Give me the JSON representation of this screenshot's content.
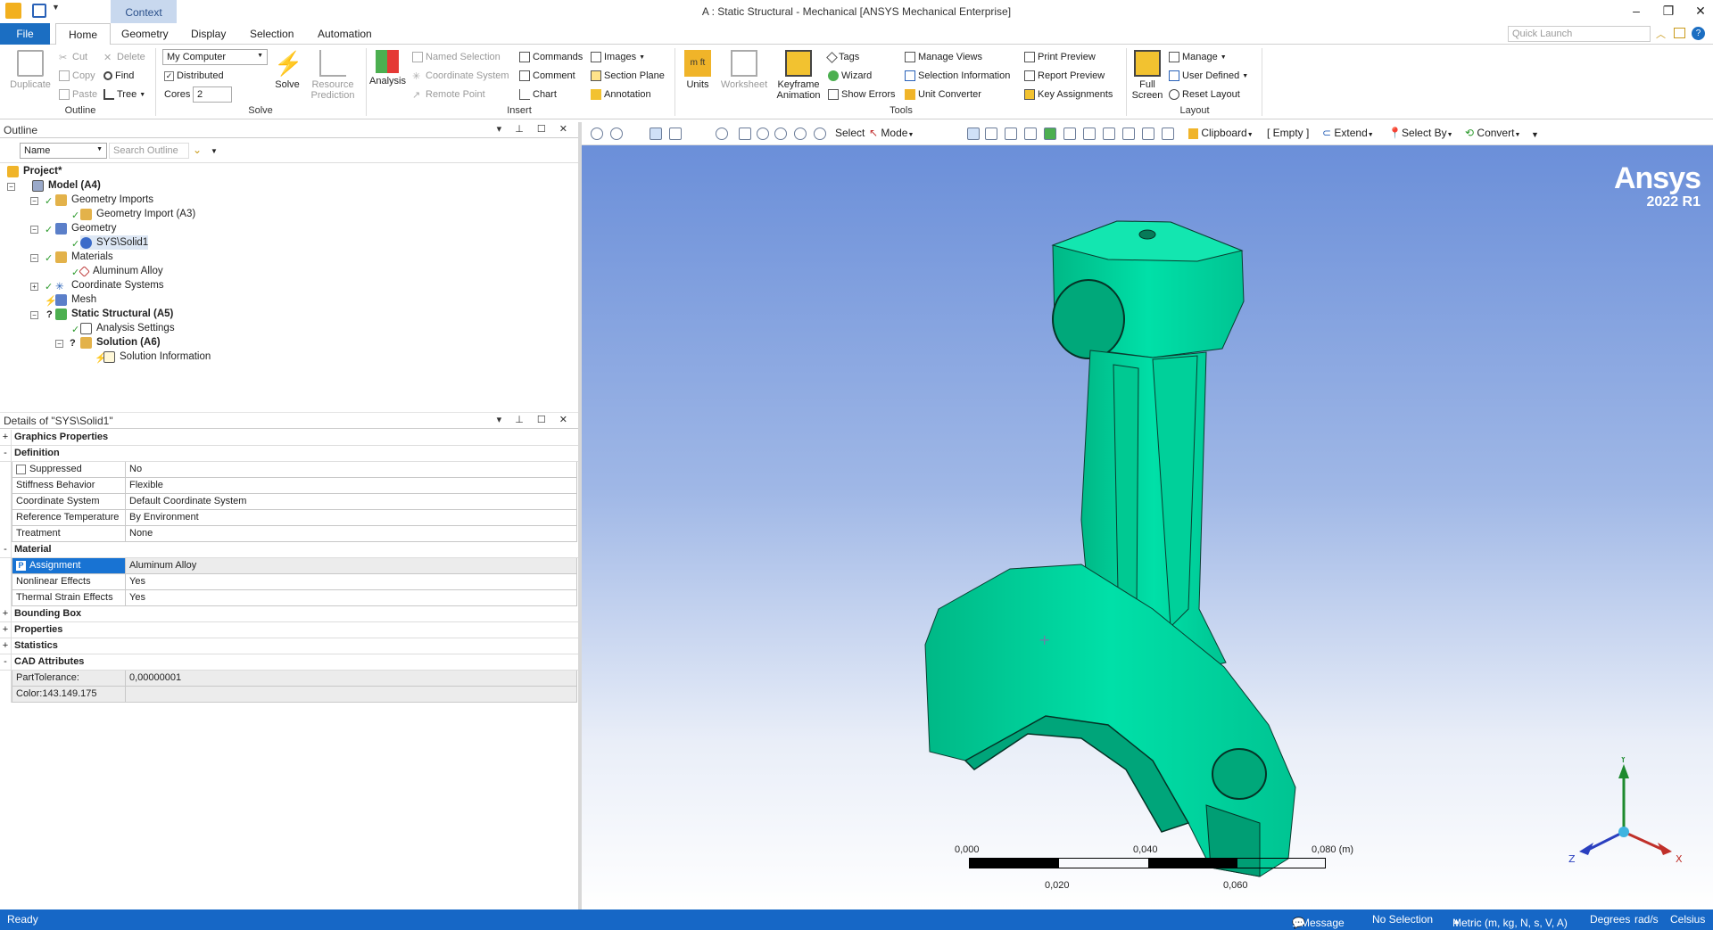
{
  "window": {
    "title": "A : Static Structural - Mechanical [ANSYS Mechanical Enterprise]",
    "context_tab": "Context"
  },
  "ribbon_tabs": [
    "File",
    "Home",
    "Geometry",
    "Display",
    "Selection",
    "Automation"
  ],
  "quick_launch_placeholder": "Quick Launch",
  "ribbon": {
    "outline": {
      "group_label": "Outline",
      "duplicate": "Duplicate",
      "cut": "Cut",
      "copy": "Copy",
      "paste": "Paste",
      "delete": "Delete",
      "find": "Find",
      "tree": "Tree"
    },
    "solve": {
      "group_label": "Solve",
      "computer": "My Computer",
      "distributed": "Distributed",
      "cores_label": "Cores",
      "cores_value": "2",
      "solve": "Solve",
      "resource_prediction_1": "Resource",
      "resource_prediction_2": "Prediction"
    },
    "insert": {
      "group_label": "Insert",
      "analysis": "Analysis",
      "named_selection": "Named Selection",
      "coordinate_system": "Coordinate System",
      "remote_point": "Remote Point",
      "commands": "Commands",
      "comment": "Comment",
      "chart": "Chart",
      "images": "Images",
      "section_plane": "Section Plane",
      "annotation": "Annotation"
    },
    "tools": {
      "group_label": "Tools",
      "units": "Units",
      "worksheet": "Worksheet",
      "keyframe_1": "Keyframe",
      "keyframe_2": "Animation",
      "tags": "Tags",
      "wizard": "Wizard",
      "show_errors": "Show Errors",
      "manage_views": "Manage Views",
      "selection_information": "Selection Information",
      "unit_converter": "Unit Converter",
      "print_preview": "Print Preview",
      "report_preview": "Report Preview",
      "key_assignments": "Key Assignments"
    },
    "layout": {
      "group_label": "Layout",
      "full_screen_1": "Full",
      "full_screen_2": "Screen",
      "manage": "Manage",
      "user_defined": "User Defined",
      "reset_layout": "Reset Layout"
    }
  },
  "outline_panel": {
    "title": "Outline",
    "filter_name": "Name",
    "search_placeholder": "Search Outline",
    "tree": [
      {
        "label": "Project*",
        "bold": true
      },
      {
        "label": "Model (A4)",
        "bold": true
      },
      {
        "label": "Geometry Imports",
        "bold": false
      },
      {
        "label": "Geometry Import (A3)",
        "bold": false
      },
      {
        "label": "Geometry",
        "bold": false
      },
      {
        "label": "SYS\\Solid1",
        "bold": false
      },
      {
        "label": "Materials",
        "bold": false
      },
      {
        "label": "Aluminum Alloy",
        "bold": false
      },
      {
        "label": "Coordinate Systems",
        "bold": false
      },
      {
        "label": "Mesh",
        "bold": false
      },
      {
        "label": "Static Structural (A5)",
        "bold": true
      },
      {
        "label": "Analysis Settings",
        "bold": false
      },
      {
        "label": "Solution (A6)",
        "bold": true
      },
      {
        "label": "Solution Information",
        "bold": false
      }
    ]
  },
  "details_panel": {
    "title": "Details of \"SYS\\Solid1\"",
    "rows": [
      {
        "type": "group",
        "name": "Graphics Properties",
        "expander": "+"
      },
      {
        "type": "group",
        "name": "Definition",
        "expander": "-"
      },
      {
        "type": "prop",
        "name": "Suppressed",
        "value": "No"
      },
      {
        "type": "prop",
        "name": "Stiffness Behavior",
        "value": "Flexible"
      },
      {
        "type": "prop",
        "name": "Coordinate System",
        "value": "Default Coordinate System"
      },
      {
        "type": "prop",
        "name": "Reference Temperature",
        "value": "By Environment"
      },
      {
        "type": "prop",
        "name": "Treatment",
        "value": "None"
      },
      {
        "type": "group",
        "name": "Material",
        "expander": "-"
      },
      {
        "type": "prop",
        "name": "Assignment",
        "value": "Aluminum Alloy"
      },
      {
        "type": "prop",
        "name": "Nonlinear Effects",
        "value": "Yes"
      },
      {
        "type": "prop",
        "name": "Thermal Strain Effects",
        "value": "Yes"
      },
      {
        "type": "group",
        "name": "Bounding Box",
        "expander": "+"
      },
      {
        "type": "group",
        "name": "Properties",
        "expander": "+"
      },
      {
        "type": "group",
        "name": "Statistics",
        "expander": "+"
      },
      {
        "type": "group",
        "name": "CAD Attributes",
        "expander": "-"
      },
      {
        "type": "prop",
        "name": "PartTolerance:",
        "value": "0,00000001"
      },
      {
        "type": "prop",
        "name": "Color:143.149.175",
        "value": ""
      }
    ]
  },
  "graphics_toolbar": {
    "select": "Select",
    "mode": "Mode",
    "clipboard": "Clipboard",
    "empty": "[ Empty ]",
    "extend": "Extend",
    "select_by": "Select By",
    "convert": "Convert"
  },
  "viewport": {
    "brand": "Ansys",
    "version": "2022 R1",
    "scale_labels_top": [
      "0,000",
      "0,040",
      "0,080 (m)"
    ],
    "scale_labels_bottom": [
      "0,020",
      "0,060"
    ],
    "axis_x": "X",
    "axis_y": "Y",
    "axis_z": "Z",
    "part_color": "#00d9a0"
  },
  "statusbar": {
    "ready": "Ready",
    "messages": "1 Message",
    "selection": "No Selection",
    "units": "Metric (m, kg, N, s, V, A)",
    "angle": "Degrees",
    "rate": "rad/s",
    "temp": "Celsius"
  }
}
